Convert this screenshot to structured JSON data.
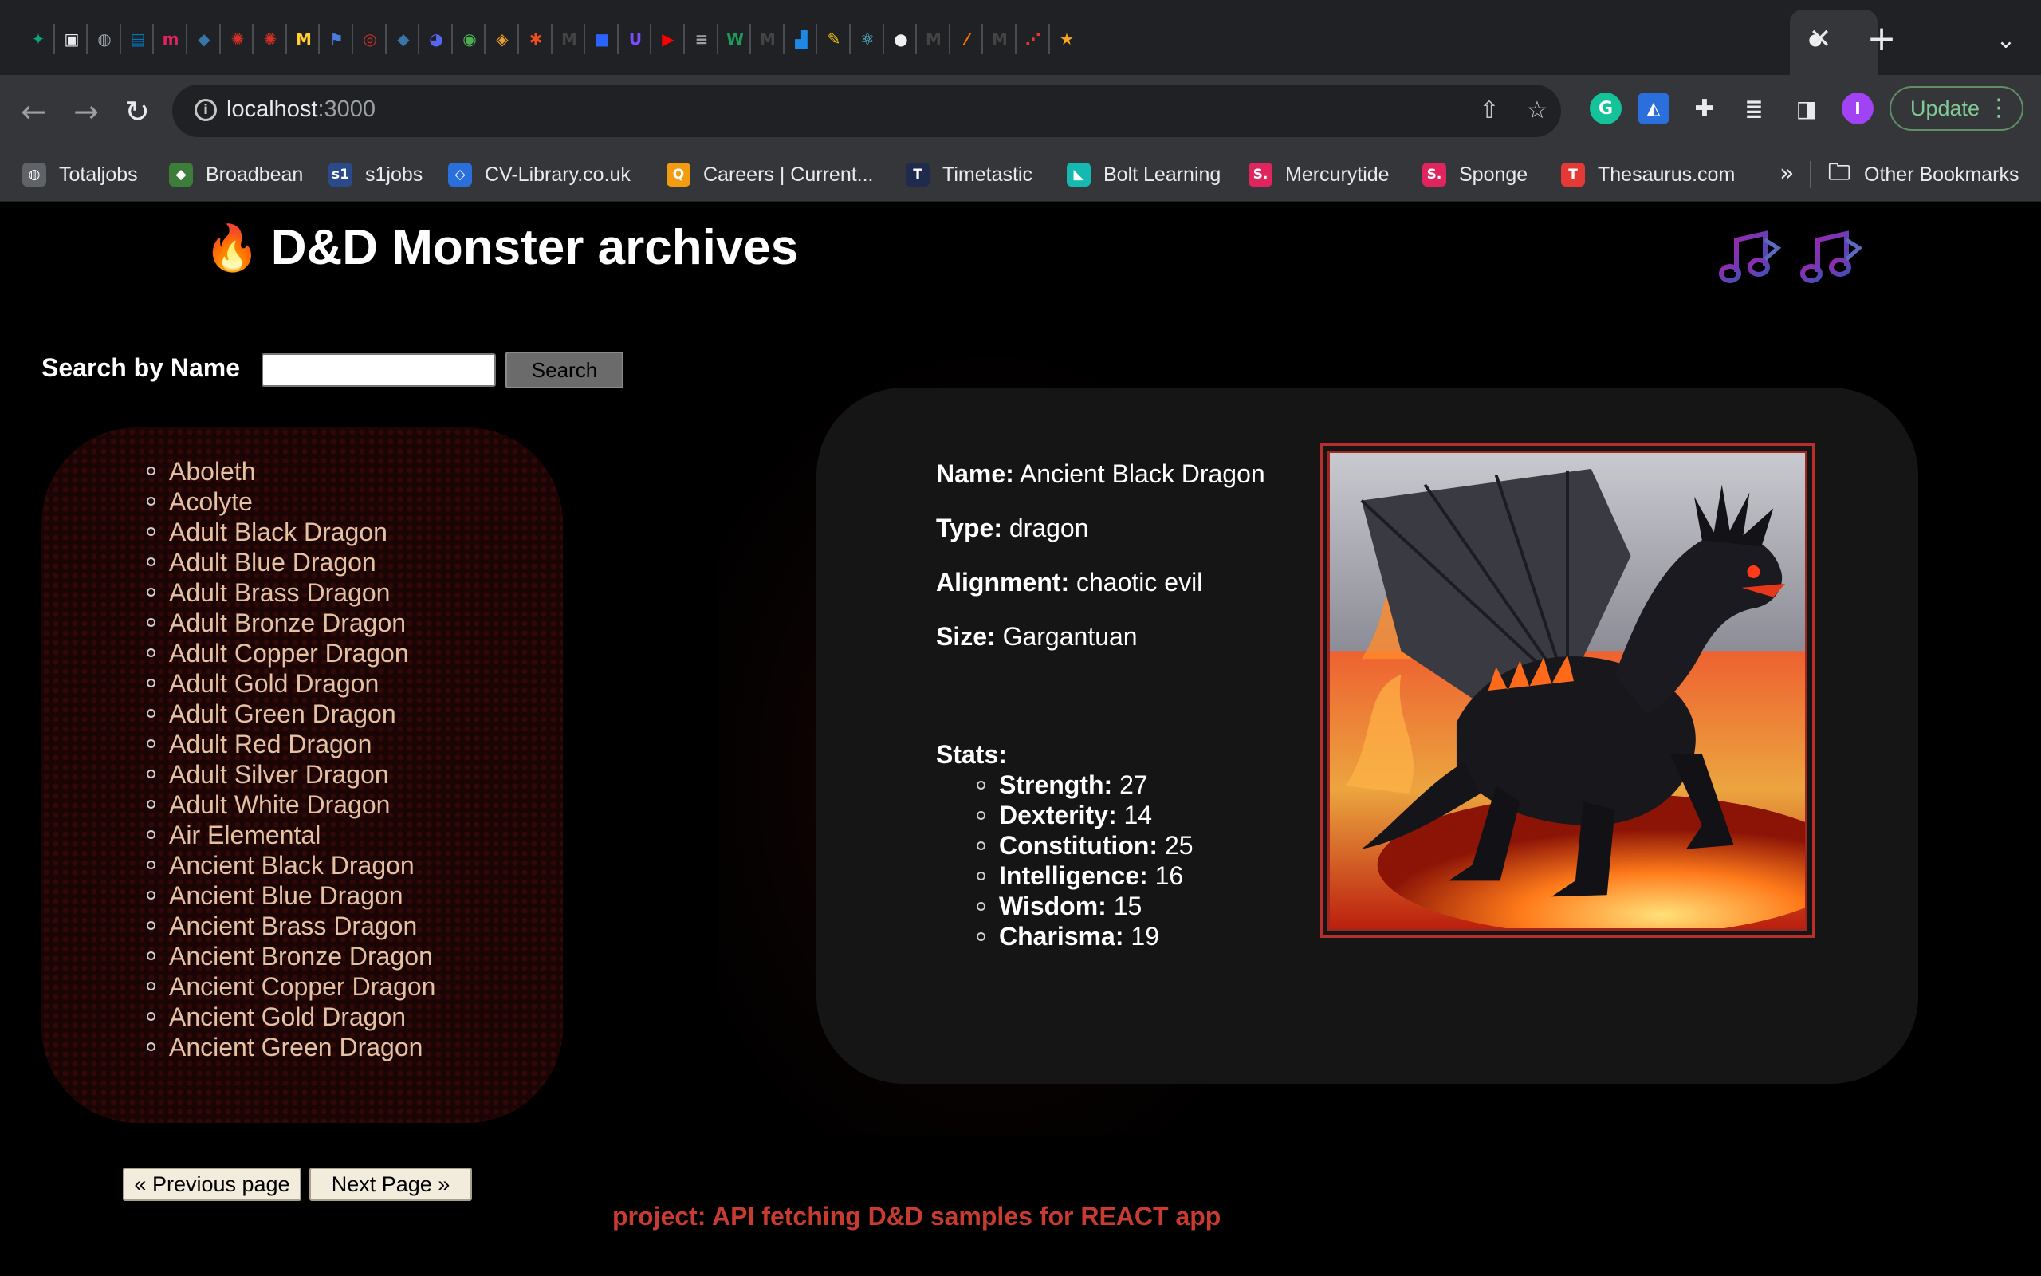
{
  "browser": {
    "tabs": [
      {
        "icon": "chatgpt-icon",
        "glyph": "✦",
        "bg": "#10a37f"
      },
      {
        "icon": "webpage-icon",
        "glyph": "▣",
        "bg": "#e8eaed"
      },
      {
        "icon": "globe-icon",
        "glyph": "◍",
        "bg": "#9aa0a6"
      },
      {
        "icon": "trello-icon",
        "glyph": "▤",
        "bg": "#0079bf"
      },
      {
        "icon": "m-icon",
        "glyph": "m",
        "bg": "#e0245e"
      },
      {
        "icon": "python-icon",
        "glyph": "◆",
        "bg": "#3776ab"
      },
      {
        "icon": "red-badge-icon",
        "glyph": "✺",
        "bg": "#d93025"
      },
      {
        "icon": "red-badge-icon",
        "glyph": "✺",
        "bg": "#d93025"
      },
      {
        "icon": "miro-icon",
        "glyph": "M",
        "bg": "#ffd02f"
      },
      {
        "icon": "flag-icon",
        "glyph": "⚑",
        "bg": "#4a7cdf"
      },
      {
        "icon": "spiral-icon",
        "glyph": "◎",
        "bg": "#c6302b"
      },
      {
        "icon": "python-icon",
        "glyph": "◆",
        "bg": "#3776ab"
      },
      {
        "icon": "discord-icon",
        "glyph": "◕",
        "bg": "#5865f2"
      },
      {
        "icon": "frog-icon",
        "glyph": "◉",
        "bg": "#4caf50"
      },
      {
        "icon": "medal-icon",
        "glyph": "◈",
        "bg": "#f0a030"
      },
      {
        "icon": "asterisk-icon",
        "glyph": "✱",
        "bg": "#f24e1e"
      },
      {
        "icon": "m-icon",
        "glyph": "M",
        "bg": "#444"
      },
      {
        "icon": "blue-square-icon",
        "glyph": "■",
        "bg": "#2962ff"
      },
      {
        "icon": "ui-icon",
        "glyph": "U",
        "bg": "#7c4dff"
      },
      {
        "icon": "youtube-icon",
        "glyph": "▶",
        "bg": "#ff0000"
      },
      {
        "icon": "database-icon",
        "glyph": "≡",
        "bg": "#9aa0a6"
      },
      {
        "icon": "w-icon",
        "glyph": "W",
        "bg": "#1c9c5b"
      },
      {
        "icon": "m-icon",
        "glyph": "M",
        "bg": "#444"
      },
      {
        "icon": "chart-icon",
        "glyph": "▟",
        "bg": "#1e88e5"
      },
      {
        "icon": "pencil-icon",
        "glyph": "✎",
        "bg": "#f6c90e"
      },
      {
        "icon": "react-icon",
        "glyph": "⚛",
        "bg": "#61dafb"
      },
      {
        "icon": "github-icon",
        "glyph": "●",
        "bg": "#f0f0f0"
      },
      {
        "icon": "m-icon",
        "glyph": "M",
        "bg": "#444"
      },
      {
        "icon": "wand-icon",
        "glyph": "⁄",
        "bg": "#f57c00"
      },
      {
        "icon": "m-icon",
        "glyph": "M",
        "bg": "#444"
      },
      {
        "icon": "dots-icon",
        "glyph": "⋰",
        "bg": "#e53935"
      },
      {
        "icon": "star-icon",
        "glyph": "★",
        "bg": "#f5a623"
      }
    ],
    "active_tab_icon": "github-icon",
    "url_host": "localhost",
    "url_port": ":3000",
    "update_label": "Update",
    "profile_initial": "I",
    "bookmarks": [
      {
        "label": "Totaljobs",
        "icon": "globe-icon",
        "glyph": "◍",
        "bg": "#5f6368"
      },
      {
        "label": "Broadbean",
        "icon": "broadbean-icon",
        "glyph": "◆",
        "bg": "#3c7d3a"
      },
      {
        "label": "s1jobs",
        "icon": "s1jobs-icon",
        "glyph": "s1",
        "bg": "#2b4a8a"
      },
      {
        "label": "CV-Library.co.uk",
        "icon": "cv-library-icon",
        "glyph": "◇",
        "bg": "#2a6fdb"
      },
      {
        "label": "Careers | Current...",
        "icon": "careers-icon",
        "glyph": "Q",
        "bg": "#f39c12"
      },
      {
        "label": "Timetastic",
        "icon": "timetastic-icon",
        "glyph": "T",
        "bg": "#1f2b4d"
      },
      {
        "label": "Bolt Learning",
        "icon": "bolt-icon",
        "glyph": "◣",
        "bg": "#16b9b1"
      },
      {
        "label": "Mercurytide",
        "icon": "mercurytide-icon",
        "glyph": "S.",
        "bg": "#e0245e"
      },
      {
        "label": "Sponge",
        "icon": "sponge-icon",
        "glyph": "S.",
        "bg": "#e0245e"
      },
      {
        "label": "Thesaurus.com",
        "icon": "thesaurus-icon",
        "glyph": "T",
        "bg": "#e53935"
      }
    ],
    "other_bookmarks": "Other Bookmarks"
  },
  "page": {
    "title_emoji": "🔥",
    "title": "D&D Monster archives",
    "search": {
      "label": "Search by Name",
      "button": "Search",
      "value": ""
    },
    "monsters": [
      "Aboleth",
      "Acolyte",
      "Adult Black Dragon",
      "Adult Blue Dragon",
      "Adult Brass Dragon",
      "Adult Bronze Dragon",
      "Adult Copper Dragon",
      "Adult Gold Dragon",
      "Adult Green Dragon",
      "Adult Red Dragon",
      "Adult Silver Dragon",
      "Adult White Dragon",
      "Air Elemental",
      "Ancient Black Dragon",
      "Ancient Blue Dragon",
      "Ancient Brass Dragon",
      "Ancient Bronze Dragon",
      "Ancient Copper Dragon",
      "Ancient Gold Dragon",
      "Ancient Green Dragon"
    ],
    "pagination": {
      "prev": "« Previous page",
      "next": "Next Page »"
    },
    "footer": "project: API fetching D&D samples for REACT app",
    "detail": {
      "name_label": "Name:",
      "name": "Ancient Black Dragon",
      "type_label": "Type:",
      "type": "dragon",
      "alignment_label": "Alignment:",
      "alignment": "chaotic evil",
      "size_label": "Size:",
      "size": "Gargantuan",
      "stats_label": "Stats:",
      "stats": [
        {
          "label": "Strength:",
          "value": "27"
        },
        {
          "label": "Dexterity:",
          "value": "14"
        },
        {
          "label": "Constitution:",
          "value": "25"
        },
        {
          "label": "Intelligence:",
          "value": "16"
        },
        {
          "label": "Wisdom:",
          "value": "15"
        },
        {
          "label": "Charisma:",
          "value": "19"
        }
      ]
    },
    "colors": {
      "accent": "#c83b30",
      "list_text": "#e3c2a3",
      "card_bg": "#151515"
    }
  }
}
